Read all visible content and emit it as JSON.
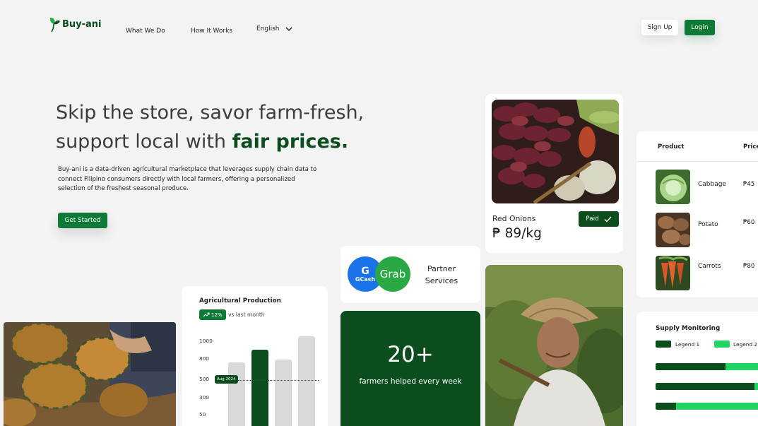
{
  "nav": {
    "brand": "Buy-ani",
    "links": [
      "What We Do",
      "How It Works"
    ],
    "language": "English",
    "signup": "Sign Up",
    "login": "Login"
  },
  "hero": {
    "title_line1": "Skip the store, savor farm-fresh,",
    "title_line2_prefix": "support local with ",
    "title_accent": "fair prices.",
    "description": "Buy-ani is a data-driven agricultural marketplace that leverages supply chain data to connect Filipino consumers directly with local farmers, offering a personalized selection of the freshest seasonal produce.",
    "cta": "Get Started"
  },
  "production": {
    "title": "Agricultural Production",
    "change": "12%",
    "change_note": "vs last month",
    "y_ticks": [
      "1000",
      "800",
      "500",
      "300",
      "50"
    ],
    "marker_label": "Aug 2024"
  },
  "chart_data": {
    "type": "bar",
    "title": "Agricultural Production",
    "values": [
      720,
      860,
      750,
      1010
    ],
    "highlight_index": 1,
    "ylim": [
      0,
      1050
    ],
    "reference_line": 500,
    "colors": {
      "normal": "#d9d9d9",
      "highlight": "#0b4d1c"
    }
  },
  "partners": {
    "gcash_label": "GCash",
    "grab_label": "Grab",
    "label": "Partner Services"
  },
  "farmers": {
    "count": "20+",
    "label": "farmers helped every week"
  },
  "featured_product": {
    "name": "Red Onions",
    "price": "₱ 89/kg",
    "status": "Paid"
  },
  "product_table": {
    "headers": {
      "product": "Product",
      "price": "Price"
    },
    "rows": [
      {
        "name": "Cabbage",
        "price": "₱45"
      },
      {
        "name": "Potato",
        "price": "₱60"
      },
      {
        "name": "Carrots",
        "price": "₱80"
      }
    ]
  },
  "supply": {
    "title": "Supply Monitoring",
    "legend1": "Legend 1",
    "legend2": "Legend 2",
    "bars": [
      0.66,
      0.93,
      0.19
    ],
    "colors": {
      "legend1": "#0b4d1c",
      "legend2": "#22d462"
    }
  },
  "colors": {
    "brand": "#0b4d1c",
    "button": "#0f7a37",
    "background": "#f3f3f3"
  }
}
